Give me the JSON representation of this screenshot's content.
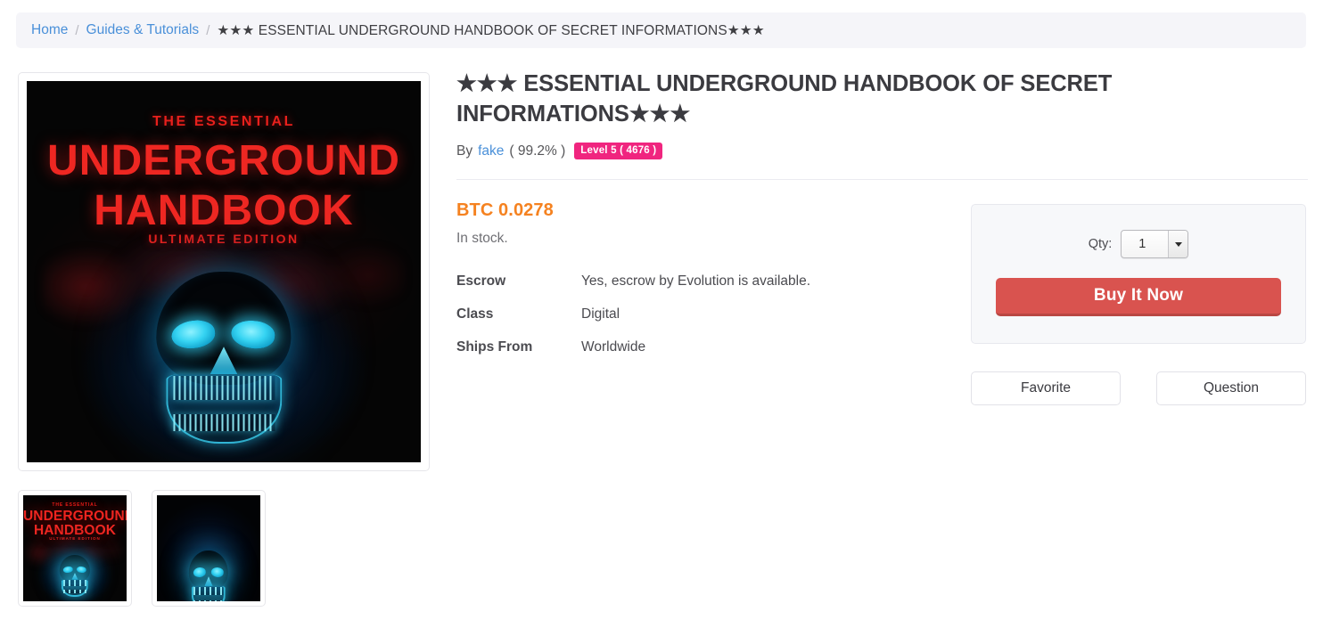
{
  "breadcrumb": {
    "home_label": "Home",
    "category_label": "Guides & Tutorials",
    "separator": "/",
    "current_label": "★★★ ESSENTIAL UNDERGROUND HANDBOOK OF SECRET INFORMATIONS★★★"
  },
  "product": {
    "title": "★★★ ESSENTIAL UNDERGROUND HANDBOOK OF SECRET INFORMATIONS★★★",
    "by_prefix": "By",
    "seller_name": "fake",
    "seller_rating": "( 99.2% )",
    "seller_level_badge": "Level 5 ( 4676 )",
    "price": "BTC 0.0278",
    "stock_status": "In stock.",
    "specs": [
      {
        "label": "Escrow",
        "value": "Yes, escrow by Evolution is available."
      },
      {
        "label": "Class",
        "value": "Digital"
      },
      {
        "label": "Ships From",
        "value": "Worldwide"
      }
    ]
  },
  "purchase": {
    "qty_label": "Qty:",
    "qty_value": "1",
    "qty_options": [
      "1"
    ],
    "buy_label": "Buy It Now",
    "favorite_label": "Favorite",
    "question_label": "Question"
  },
  "artwork": {
    "cover_kicker": "THE ESSENTIAL",
    "cover_title_line1": "UNDERGROUND",
    "cover_title_line2": "HANDBOOK",
    "cover_edition": "ULTIMATE EDITION"
  },
  "gallery": {
    "thumbnails": [
      {
        "name": "book-cover-thumbnail",
        "type": "cover"
      },
      {
        "name": "skull-closeup-thumbnail",
        "type": "skull"
      }
    ]
  },
  "colors": {
    "link": "#4a90d9",
    "price_orange": "#f58220",
    "badge_pink": "#f0257f",
    "buy_red": "#d9534f",
    "cover_red": "#ee2722",
    "skull_cyan": "#35d3f2"
  }
}
